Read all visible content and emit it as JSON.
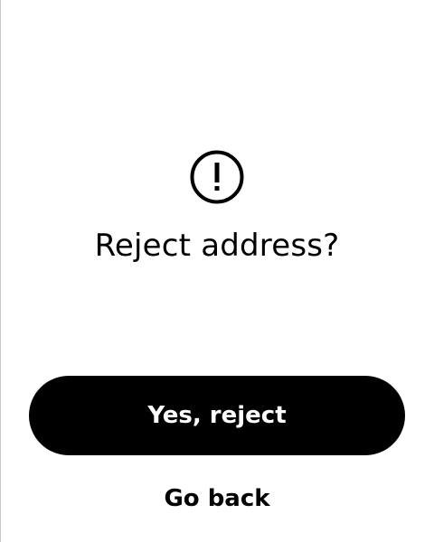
{
  "dialog": {
    "icon": "exclamation-circle-icon",
    "title": "Reject address?",
    "confirm_label": "Yes, reject",
    "cancel_label": "Go back"
  },
  "colors": {
    "background": "#ffffff",
    "primary_button": "#000000",
    "primary_button_text": "#ffffff",
    "text": "#000000"
  }
}
